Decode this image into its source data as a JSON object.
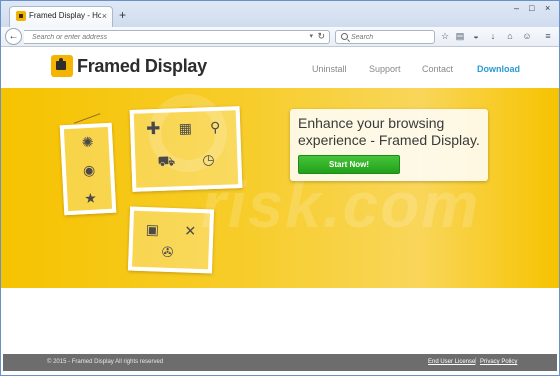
{
  "browser": {
    "tab": {
      "title": "Framed Display - Home Pa...",
      "close_glyph": "×"
    },
    "new_tab_glyph": "+",
    "window_controls": {
      "minimize": "–",
      "maximize": "□",
      "close": "×"
    },
    "nav": {
      "back_glyph": "←",
      "url_placeholder": "Search or enter address",
      "dropdown_glyph": "▾",
      "reload_glyph": "↻",
      "search_placeholder": "Search"
    },
    "toolbar_icons": [
      "bookmark-star-icon",
      "reading-list-icon",
      "pocket-icon",
      "downloads-icon",
      "home-icon",
      "chat-icon",
      "menu-icon"
    ],
    "toolbar_glyphs": {
      "star": "☆",
      "list": "▤",
      "pocket": "◒",
      "download": "↓",
      "home": "⌂",
      "chat": "☺",
      "menu": "≡"
    }
  },
  "site": {
    "logo_text": "Framed Display",
    "nav": [
      {
        "label": "Uninstall"
      },
      {
        "label": "Support"
      },
      {
        "label": "Contact"
      },
      {
        "label": "Download"
      }
    ],
    "hero": {
      "headline": "Enhance your browsing experience - Framed Display.",
      "cta_label": "Start Now!",
      "watermark": "risk.com"
    },
    "footer": {
      "copyright": "© 2015 - Framed Display All rights reserved",
      "eula": "End User License",
      "separator": "|",
      "privacy": "Privacy Policy"
    }
  },
  "colors": {
    "hero_yellow": "#f6c300",
    "download_link": "#2a9ad4",
    "cta_green": "#2fb026",
    "footer_gray": "#6d6d6d"
  }
}
